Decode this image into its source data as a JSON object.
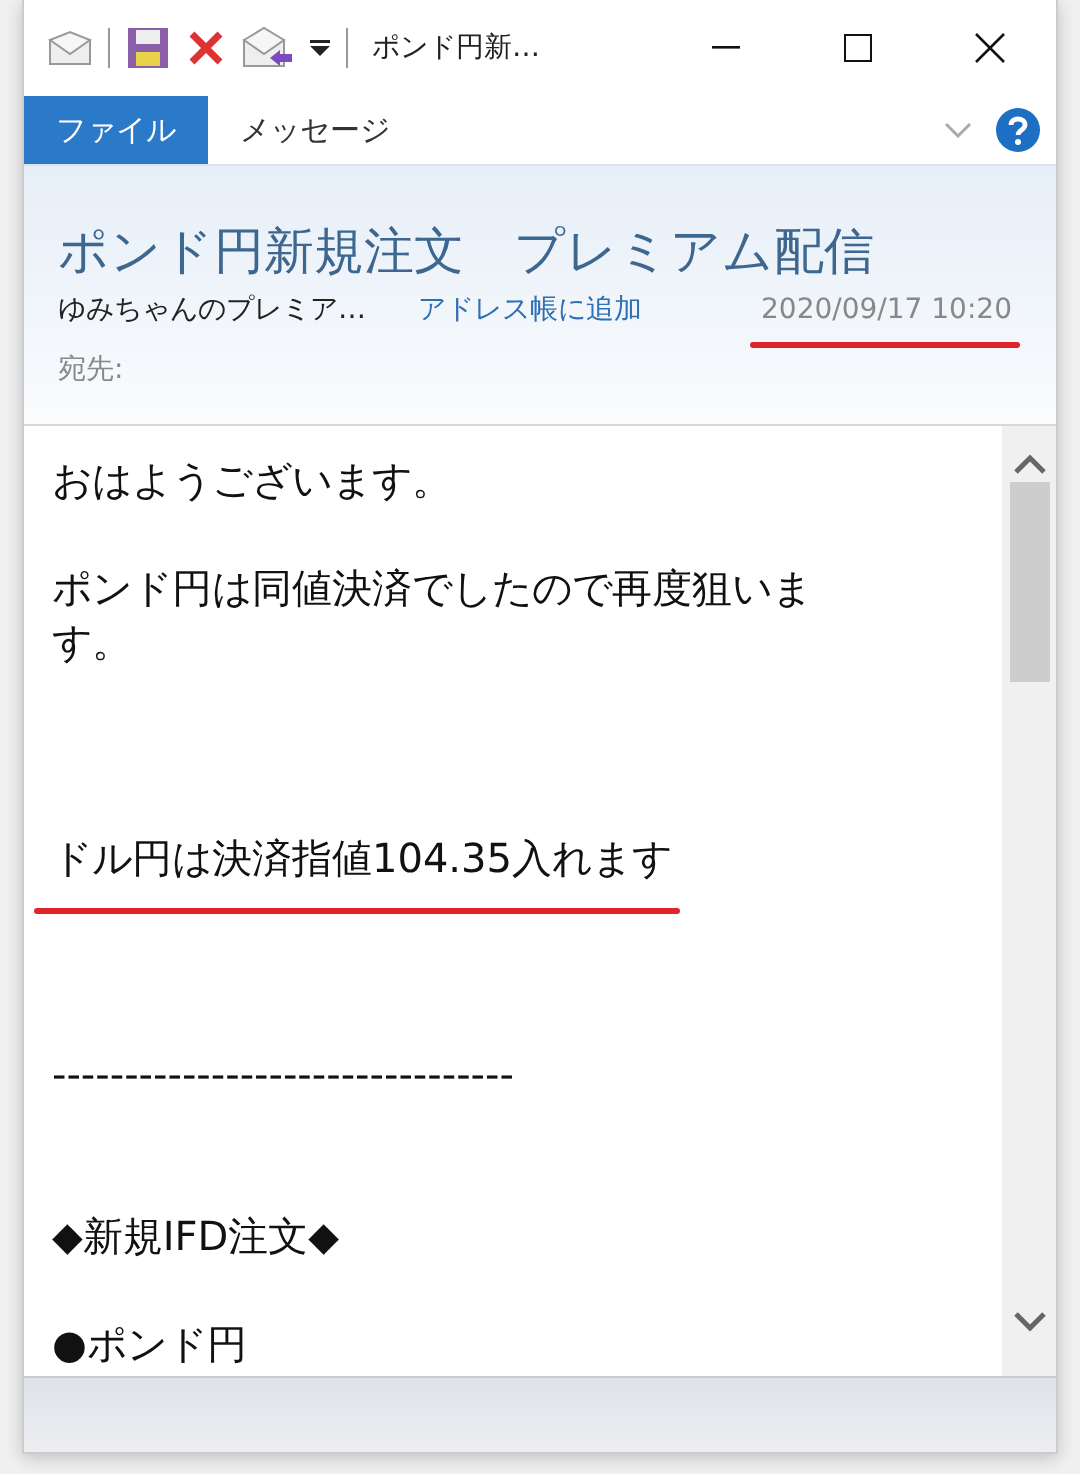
{
  "window": {
    "title": "ポンド円新…"
  },
  "ribbon": {
    "tabs": [
      {
        "label": "ファイル",
        "selected": true
      },
      {
        "label": "メッセージ",
        "selected": false
      }
    ]
  },
  "header": {
    "subject": "ポンド円新規注文　プレミアム配信",
    "sender": "ゆみちゃんのプレミア…",
    "add_contact": "アドレス帳に追加",
    "date": {
      "text": "2020/09/17 10:20",
      "underlined": true
    },
    "to_label": "宛先:"
  },
  "body": [
    {
      "kind": "text",
      "text": "おはようございます。",
      "underlined": false
    },
    {
      "kind": "blank"
    },
    {
      "kind": "text",
      "text": "ポンド円は同値決済でしたので再度狙います。",
      "underlined": false
    },
    {
      "kind": "blank"
    },
    {
      "kind": "blank"
    },
    {
      "kind": "blank"
    },
    {
      "kind": "text",
      "text": "ドル円は決済指値104.35入れます",
      "underlined": true
    },
    {
      "kind": "blank"
    },
    {
      "kind": "blank"
    },
    {
      "kind": "blank"
    },
    {
      "kind": "text",
      "text": "--------------------------------",
      "underlined": false
    },
    {
      "kind": "blank"
    },
    {
      "kind": "blank"
    },
    {
      "kind": "text",
      "text": "◆新規IFD注文◆",
      "underlined": false
    },
    {
      "kind": "blank"
    },
    {
      "kind": "text",
      "text": "●ポンド円",
      "underlined": false
    }
  ]
}
